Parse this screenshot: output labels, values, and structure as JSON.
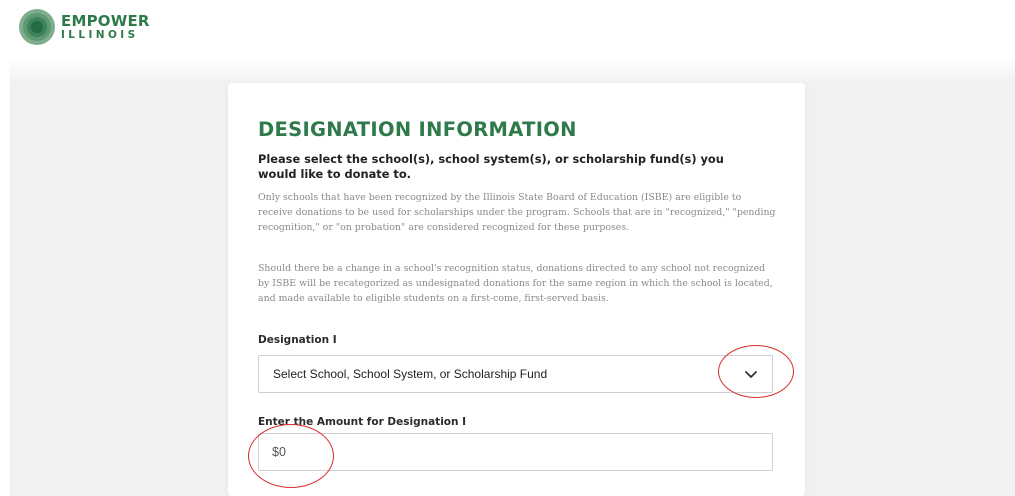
{
  "brand": {
    "name_line1": "EMPOWER",
    "name_line2": "ILLINOIS",
    "color": "#2f7a4b"
  },
  "form": {
    "title": "DESIGNATION INFORMATION",
    "prompt": "Please select the school(s), school system(s), or scholarship fund(s) you would like to donate to.",
    "paragraph1": "Only schools that have been recognized by the Illinois State Board of Education (ISBE) are eligible to receive donations to be used for scholarships under the program. Schools that are in \"recognized,\" \"pending recognition,\" or \"on probation\" are considered recognized for these purposes.",
    "paragraph2": "Should there be a change in a school's recognition status, donations directed to any school not recognized by ISBE will be recategorized as undesignated donations for the same region in which the school is located, and made available to eligible students on a first-come, first-served basis.",
    "designation_label": "Designation I",
    "designation_select_value": "Select School, School System, or Scholarship Fund",
    "amount_label": "Enter the Amount for Designation I",
    "amount_value": "$0"
  },
  "icons": {
    "dropdown": "chevron-down-icon",
    "logo": "empower-illinois-logo-icon"
  },
  "annotations": {
    "color": "#d4302c"
  }
}
